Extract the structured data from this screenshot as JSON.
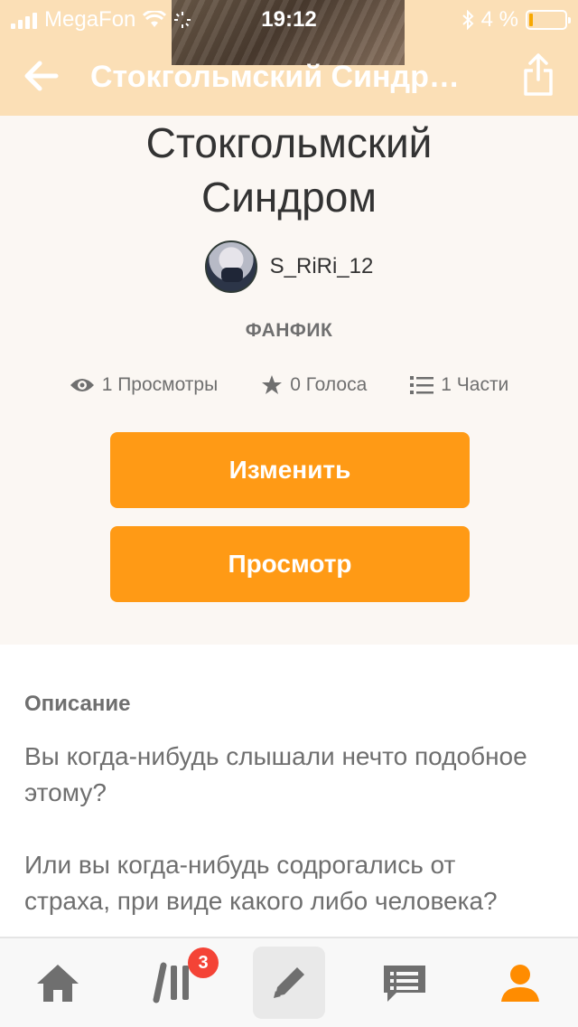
{
  "status_bar": {
    "carrier": "MegaFon",
    "time": "19:12",
    "battery": "4 %"
  },
  "nav": {
    "title": "Стокгольмский Синдр…"
  },
  "story": {
    "title": "Стокгольмский Синдром",
    "author": "S_RiRi_12",
    "type": "ФАНФИК",
    "stats": {
      "views": "1 Просмотры",
      "votes": "0 Голоса",
      "parts": "1 Части"
    },
    "edit_label": "Изменить",
    "preview_label": "Просмотр"
  },
  "description": {
    "label": "Описание",
    "paragraph1": "Вы когда-нибудь слышали нечто подобное этому?",
    "paragraph2": "Или вы когда-нибудь содрогались от страха, при виде какого либо человека?"
  },
  "tabbar": {
    "library_badge": "3"
  },
  "colors": {
    "accent": "#ff9a15",
    "header_bg": "#fbdfb6",
    "badge": "#f44336",
    "profile_active": "#ff8c00"
  }
}
